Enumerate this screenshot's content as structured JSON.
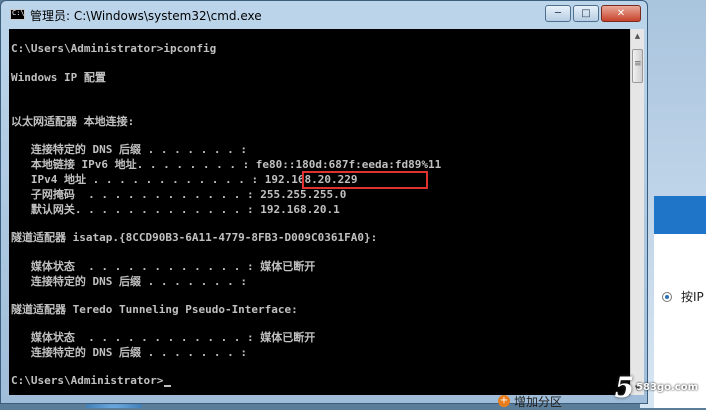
{
  "window": {
    "title": "管理员: C:\\Windows\\system32\\cmd.exe",
    "minimize": "─",
    "maximize": "□",
    "close": "✕"
  },
  "console_lines": [
    "C:\\Users\\Administrator>ipconfig",
    "Windows IP 配置",
    "以太网适配器 本地连接:",
    "   连接特定的 DNS 后缀 . . . . . . . :",
    "   本地链接 IPv6 地址. . . . . . . . : fe80::180d:687f:eeda:fd89%11",
    "   IPv4 地址 . . . . . . . . . . . . : 192.168.20.229",
    "   子网掩码  . . . . . . . . . . . . : 255.255.255.0",
    "   默认网关. . . . . . . . . . . . . : 192.168.20.1",
    "隧道适配器 isatap.{8CCD90B3-6A11-4779-8FB3-D009C0361FA0}:",
    "   媒体状态  . . . . . . . . . . . . : 媒体已断开",
    "   连接特定的 DNS 后缀 . . . . . . . :",
    "隧道适配器 Teredo Tunneling Pseudo-Interface:",
    "   媒体状态  . . . . . . . . . . . . : 媒体已断开",
    "   连接特定的 DNS 后缀 . . . . . . . :",
    "C:\\Users\\Administrator>"
  ],
  "background": {
    "radio_label": "按IP",
    "add_partition": "增加分区",
    "add_icon": "+"
  },
  "watermark": {
    "digit": "5",
    "site": "583go.com"
  },
  "colors": {
    "console_bg": "#000000",
    "console_text": "#c0c0c0",
    "highlight": "#e0332f"
  }
}
